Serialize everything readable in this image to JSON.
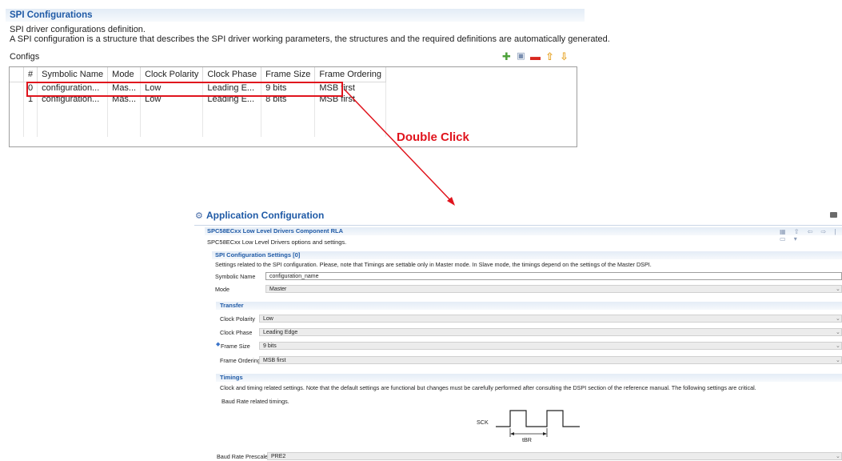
{
  "top": {
    "title": "SPI Configurations",
    "description1": "SPI driver configurations definition.",
    "description2": "A SPI configuration is a structure that describes the SPI driver working parameters, the structures and the required definitions are automatically generated.",
    "configs_label": "Configs",
    "toolbar": [
      "add-icon",
      "duplicate-icon",
      "remove-icon",
      "move-up-icon",
      "move-down-icon"
    ],
    "table": {
      "headers": [
        "#",
        "Symbolic Name",
        "Mode",
        "Clock Polarity",
        "Clock Phase",
        "Frame Size",
        "Frame Ordering"
      ],
      "rows": [
        [
          "0",
          "configuration...",
          "Mas...",
          "Low",
          "Leading E...",
          "9 bits",
          "MSB first"
        ],
        [
          "1",
          "configuration...",
          "Mas...",
          "Low",
          "Leading E...",
          "8 bits",
          "MSB first"
        ]
      ]
    }
  },
  "annotation": {
    "label": "Double Click",
    "color": "#e0141d"
  },
  "app": {
    "title": "Application Configuration",
    "component_title": "SPC58ECxx Low Level Drivers Component RLA",
    "component_desc": "SPC58ECxx Low Level Drivers options and settings.",
    "spi_section_title": "SPI Configuration Settings [0]",
    "spi_section_desc": "Settings related to the SPI configuration. Please, note that Timings are settable only in Master mode. In Slave mode, the timings depend on the settings of the Master DSPI.",
    "symbolic_name_label": "Symbolic Name",
    "symbolic_name_value": "configuration_name",
    "mode_label": "Mode",
    "mode_value": "Master",
    "transfer_title": "Transfer",
    "clock_polarity_label": "Clock Polarity",
    "clock_polarity_value": "Low",
    "clock_phase_label": "Clock Phase",
    "clock_phase_value": "Leading Edge",
    "frame_size_label": "Frame Size",
    "frame_size_value": "9 bits",
    "frame_ordering_label": "Frame Ordering",
    "frame_ordering_value": "MSB first",
    "timings_title": "Timings",
    "timings_desc": "Clock and timing related settings. Note that the default settings are functional but changes must be carefully performed after consulting the DSPI section of the reference manual. The following settings are critical.",
    "baud_desc": "Baud Rate related timings.",
    "diagram_sck": "SCK",
    "diagram_tbr": "tBR",
    "baud_prescaler_label": "Baud Rate Prescaler",
    "baud_prescaler_value": "PRE2"
  }
}
